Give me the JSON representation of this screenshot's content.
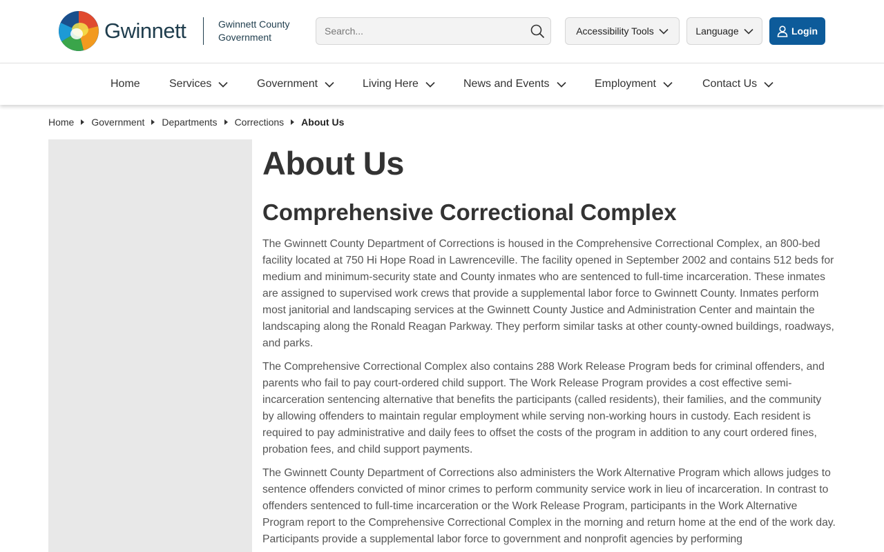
{
  "header": {
    "logo_word": "Gwinnett",
    "org_name_line1": "Gwinnett County",
    "org_name_line2": "Government",
    "search_placeholder": "Search...",
    "accessibility_label": "Accessibility Tools",
    "language_label": "Language",
    "login_label": "Login",
    "accent_color": "#0d5b9a"
  },
  "nav": {
    "items": [
      {
        "label": "Home"
      },
      {
        "label": "Services"
      },
      {
        "label": "Government"
      },
      {
        "label": "Living Here"
      },
      {
        "label": "News and Events"
      },
      {
        "label": "Employment"
      },
      {
        "label": "Contact Us"
      }
    ]
  },
  "breadcrumb": {
    "items": [
      "Home",
      "Government",
      "Departments",
      "Corrections"
    ],
    "current": "About Us"
  },
  "main": {
    "title": "About Us",
    "section_title": "Comprehensive Correctional Complex",
    "paragraphs": [
      "The Gwinnett County Department of Corrections is housed in the Comprehensive Correctional Complex, an 800-bed facility located at 750 Hi Hope Road in Lawrenceville. The facility opened in September 2002 and contains 512 beds for medium and minimum-security state and County inmates who are sentenced to full-time incarceration. These inmates are assigned to supervised work crews that provide a supplemental labor force to Gwinnett County. Inmates perform most janitorial and landscaping services at the Gwinnett County Justice and Administration Center and maintain the landscaping along the Ronald Reagan Parkway. They perform similar tasks at other county-owned buildings, roadways, and parks.",
      "The Comprehensive Correctional Complex also contains 288 Work Release Program beds for criminal offenders, and parents who fail to pay court-ordered child support. The Work Release Program provides a cost effective semi-incarceration sentencing alternative that benefits the participants (called residents), their families, and the community by allowing offenders to maintain regular employment while serving non-working hours in custody. Each resident is required to pay administrative and daily fees to offset the costs of the program in addition to any court ordered fines, probation fees, and child support payments.",
      "The Gwinnett County Department of Corrections also administers the Work Alternative Program which allows judges to sentence offenders convicted of minor crimes to perform community service work in lieu of incarceration. In contrast to offenders sentenced to full-time incarceration or the Work Release Program, participants in the Work Alternative Program report to the Comprehensive Correctional Complex in the morning and return home at the end of the work day. Participants provide a supplemental labor force to government and nonprofit agencies by performing"
    ]
  }
}
